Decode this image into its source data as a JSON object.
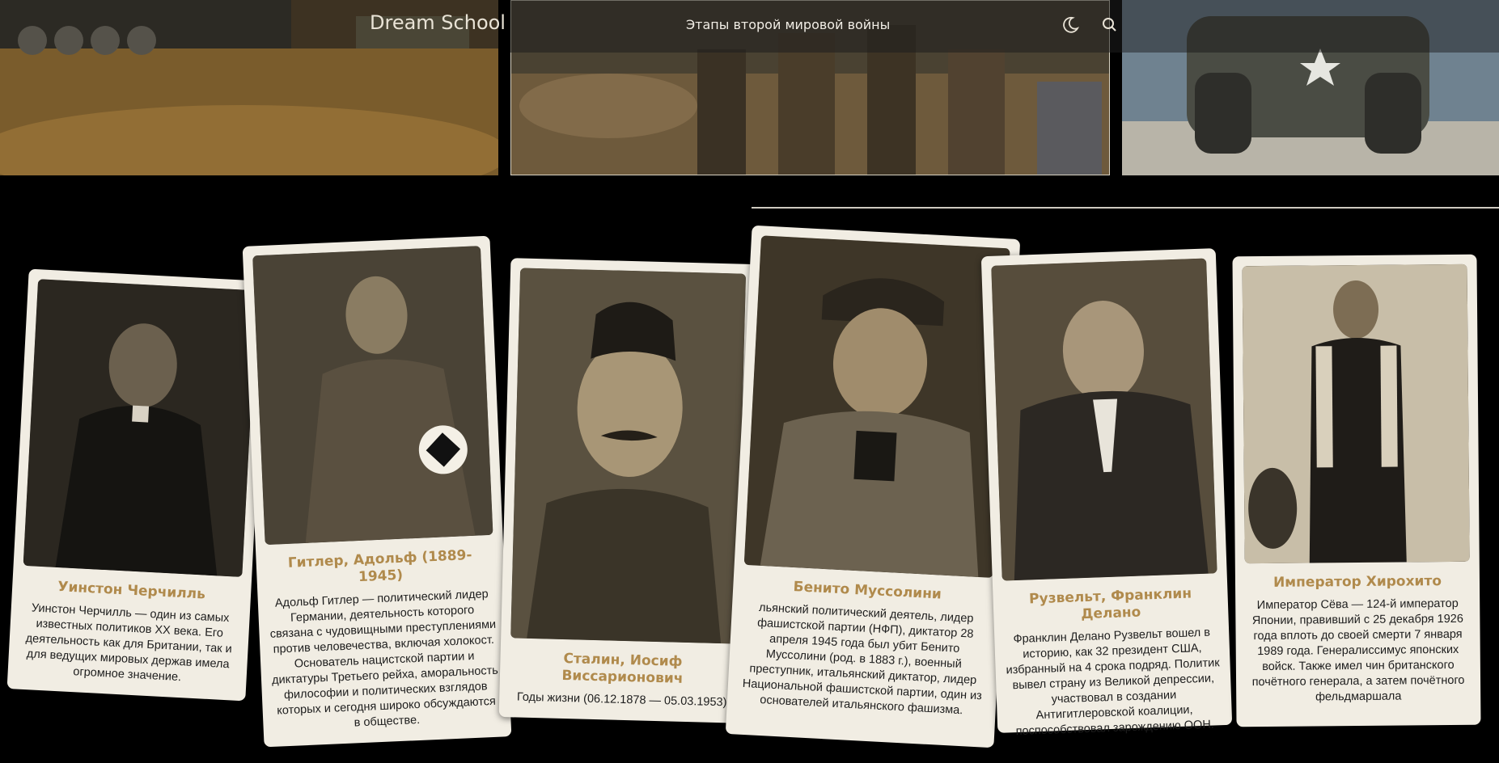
{
  "header": {
    "logo": "Dream School",
    "title": "Этапы второй мировой войны",
    "icons": [
      "moon-icon",
      "search-icon"
    ]
  },
  "colors": {
    "background": "#000000",
    "card_bg": "#f1ede3",
    "name_color": "#b08a4c",
    "header_text": "#f2eee6"
  },
  "cards": [
    {
      "name": "Уинстон Черчилль",
      "description": "Уинстон Черчилль — один из самых известных политиков XX века. Его деятельность как для Британии, так и для ведущих мировых держав имела огромное значение."
    },
    {
      "name": "Гитлер, Адольф (1889-1945)",
      "description": "Адольф Гитлер — политический лидер Германии, деятельность которого связана с чудовищными преступлениями против человечества, включая холокост. Основатель нацистской партии и диктатуры Третьего рейха, аморальность философии и политических взглядов которых и сегодня широко обсуждаются в обществе."
    },
    {
      "name": "Сталин, Иосиф Виссарионович",
      "description": "Годы жизни (06.12.1878 — 05.03.1953)"
    },
    {
      "name": "Бенито Муссолини",
      "description": "льянский политический деятель, лидер фашистской партии (НФП), диктатор 28 апреля 1945 года был убит Бенито Муссолини (род. в 1883 г.), военный преступник, итальянский диктатор, лидер Национальной фашистской партии, один из основателей итальянского фашизма."
    },
    {
      "name": "Рузвельт, Франклин Делано",
      "description": "Франклин Делано Рузвельт вошел в историю, как 32 президент США, избранный на 4 срока подряд. Политик вывел страну из Великой депрессии, участвовал в создании Антигитлеровской коалиции, поспособствовал зарождению ООН."
    },
    {
      "name": "Император Хирохито",
      "description": "Император Сёва — 124-й император Японии, правивший с 25 декабря 1926 года вплоть до своей смерти 7 января 1989 года. Генералиссимус японских войск. Также имел чин британского почётного генерала, а затем почётного фельдмаршала"
    }
  ]
}
